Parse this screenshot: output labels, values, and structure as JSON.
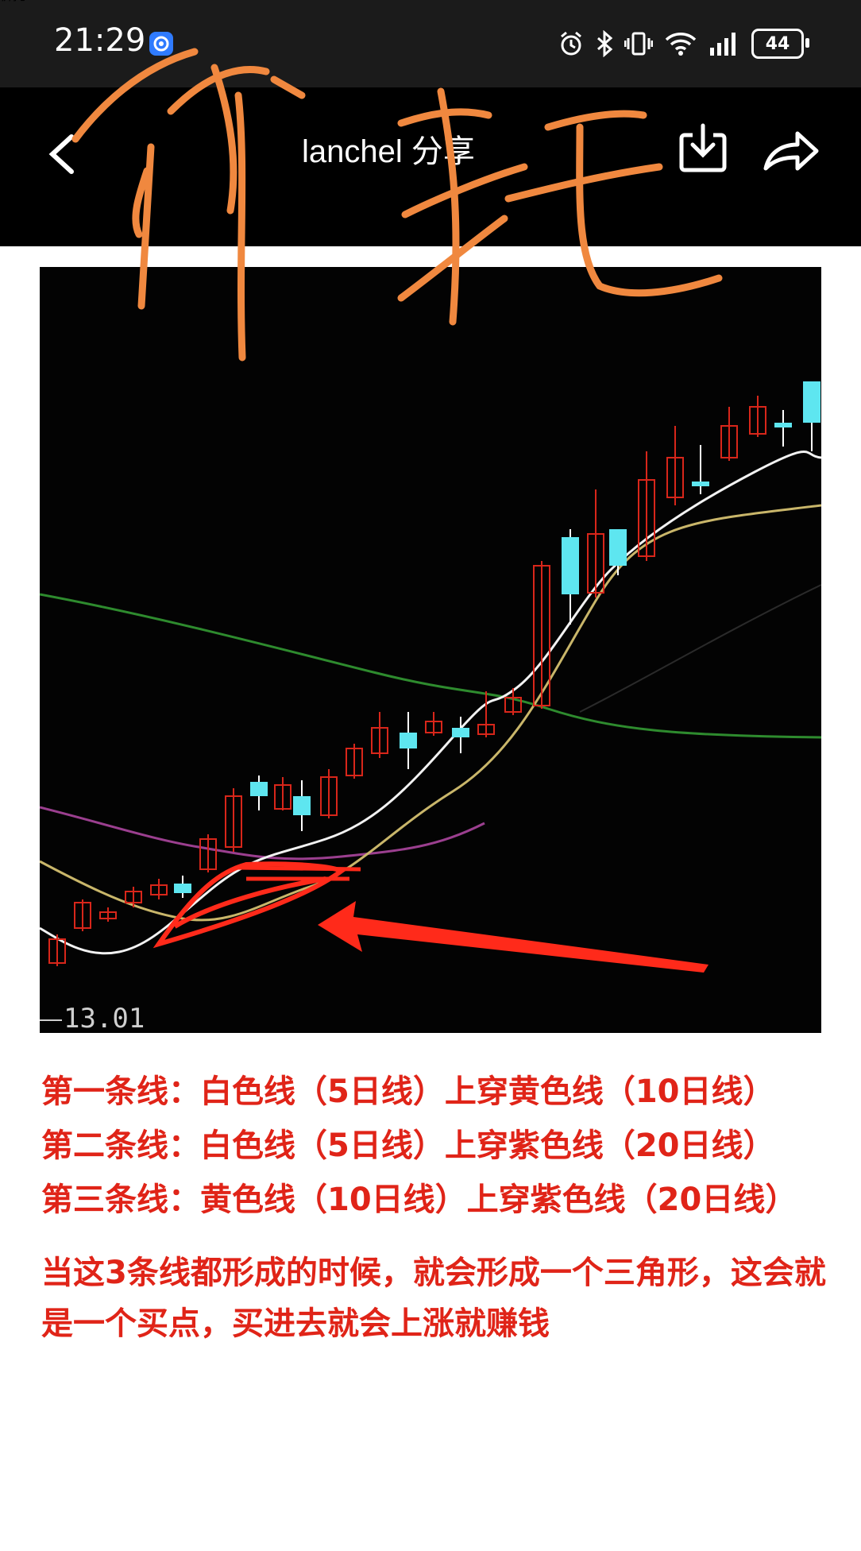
{
  "status_bar": {
    "time": "21:29",
    "battery_level": "44",
    "icons": [
      "app-notification-icon",
      "alarm-icon",
      "bluetooth-icon",
      "vibrate-icon",
      "wifi-icon",
      "signal-icon",
      "battery-icon"
    ]
  },
  "nav": {
    "title": "lanchel 分享",
    "back_icon": "chevron-left-icon",
    "download_icon": "download-icon",
    "share_icon": "share-arrow-icon"
  },
  "overlay_handwriting": {
    "text": "价托",
    "color": "#f0883f"
  },
  "chart": {
    "axis_label": "13.01",
    "colors": {
      "background": "#030303",
      "rising_candle": "#d8261a",
      "falling_candle": "#5ee6f0",
      "ma5_white": "#f2f2f2",
      "ma10_yellow": "#c9b66a",
      "ma20_purple": "#9b3f8f",
      "long_ma_green": "#2e8b2e",
      "annotation_red": "#ff2a1a"
    }
  },
  "article": {
    "lines": [
      "第一条线：白色线（5日线）上穿黄色线（10日线）",
      "第二条线：白色线（5日线）上穿紫色线（20日线）",
      "第三条线：黄色线（10日线）上穿紫色线（20日线）"
    ],
    "conclusion": "当这3条线都形成的时候，就会形成一个三角形，这会就是一个买点，买进去就会上涨就赚钱",
    "text_color": "#e02418"
  }
}
